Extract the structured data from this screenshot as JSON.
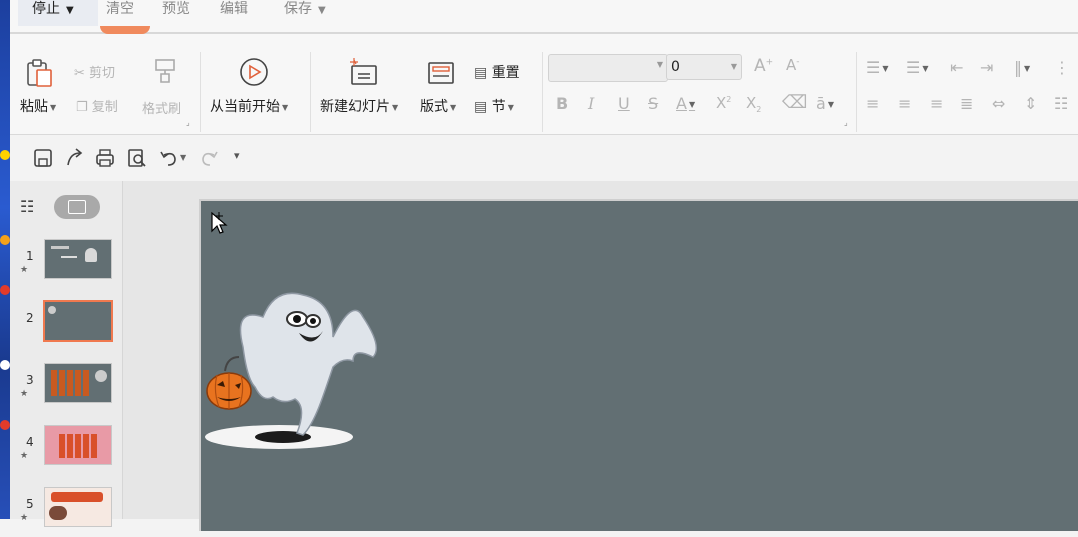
{
  "recording_bar": {
    "stop": "停止",
    "clear": "清空",
    "preview": "预览",
    "edit": "编辑",
    "save": "保存"
  },
  "ribbon": {
    "paste": "粘贴",
    "cut": "剪切",
    "copy": "复制",
    "format_painter": "格式刷",
    "from_current": "从当前开始",
    "new_slide": "新建幻灯片",
    "layout": "版式",
    "reset": "重置",
    "section": "节",
    "font_name": "",
    "font_size": "0",
    "grow_font": "A",
    "shrink_font": "A",
    "bold": "B",
    "italic": "I",
    "underline": "U",
    "strike": "S",
    "font_color": "A",
    "superscript": "X",
    "subscript": "X",
    "char_spacing": "ā"
  },
  "thumbnails": [
    {
      "num": "1",
      "star": true,
      "selected": false
    },
    {
      "num": "2",
      "star": false,
      "selected": true
    },
    {
      "num": "3",
      "star": true,
      "selected": false
    },
    {
      "num": "4",
      "star": true,
      "selected": false
    },
    {
      "num": "5",
      "star": true,
      "selected": false
    }
  ],
  "colors": {
    "slide_bg": "#626f73",
    "accent": "#f0794f"
  },
  "icons": {
    "cursor": "move-cursor-icon",
    "ghost": "ghost-image",
    "pumpkin": "pumpkin-image"
  }
}
